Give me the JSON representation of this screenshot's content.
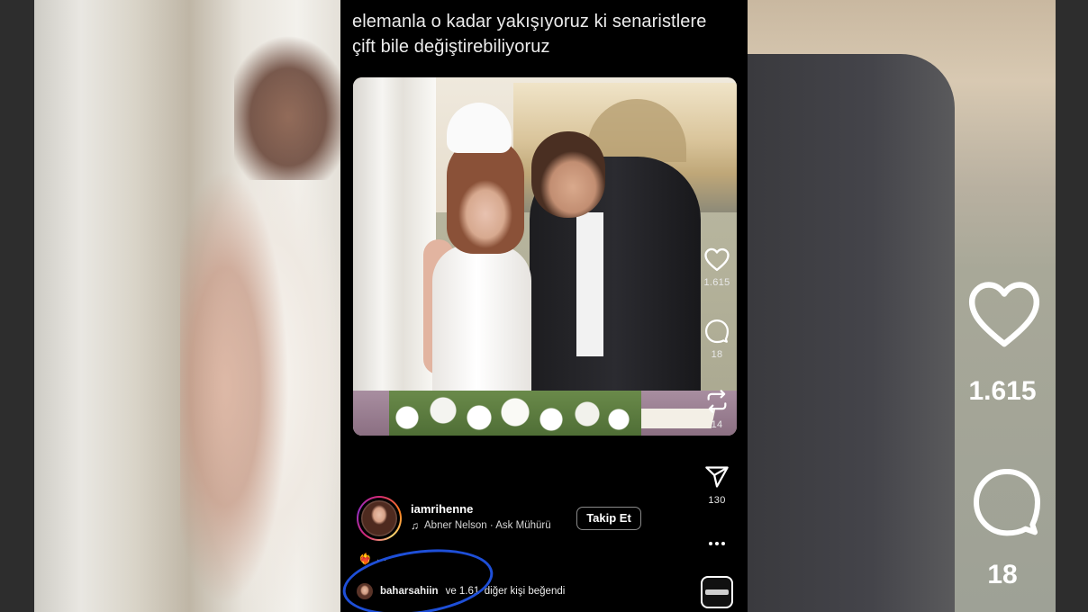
{
  "caption": {
    "text": "elemanla o kadar yakışıyoruz ki senaristlere çift bile değiştirebiliyoruz"
  },
  "actions": {
    "likes": "1.615",
    "comments": "18",
    "reposts": "14",
    "shares": "130"
  },
  "background_overlay": {
    "likes": "1.615",
    "comments": "18"
  },
  "profile": {
    "username": "iamrihenne",
    "music": "Abner Nelson · Ask Mühürü",
    "follow_label": "Takip Et"
  },
  "reactions": {
    "emoji": "❤️‍🔥",
    "dots": "..."
  },
  "liked_by": {
    "username": "baharsahiin",
    "rest": "ve 1.61  diğer kişi beğendi"
  },
  "icons": {
    "like": "heart-icon",
    "comment": "comment-bubble-icon",
    "repost": "repost-icon",
    "share": "send-icon",
    "more": "more-icon",
    "music": "music-note-icon"
  },
  "colors": {
    "annotation_circle": "#1e4fd8",
    "background": "#000000",
    "text": "#ffffff"
  }
}
